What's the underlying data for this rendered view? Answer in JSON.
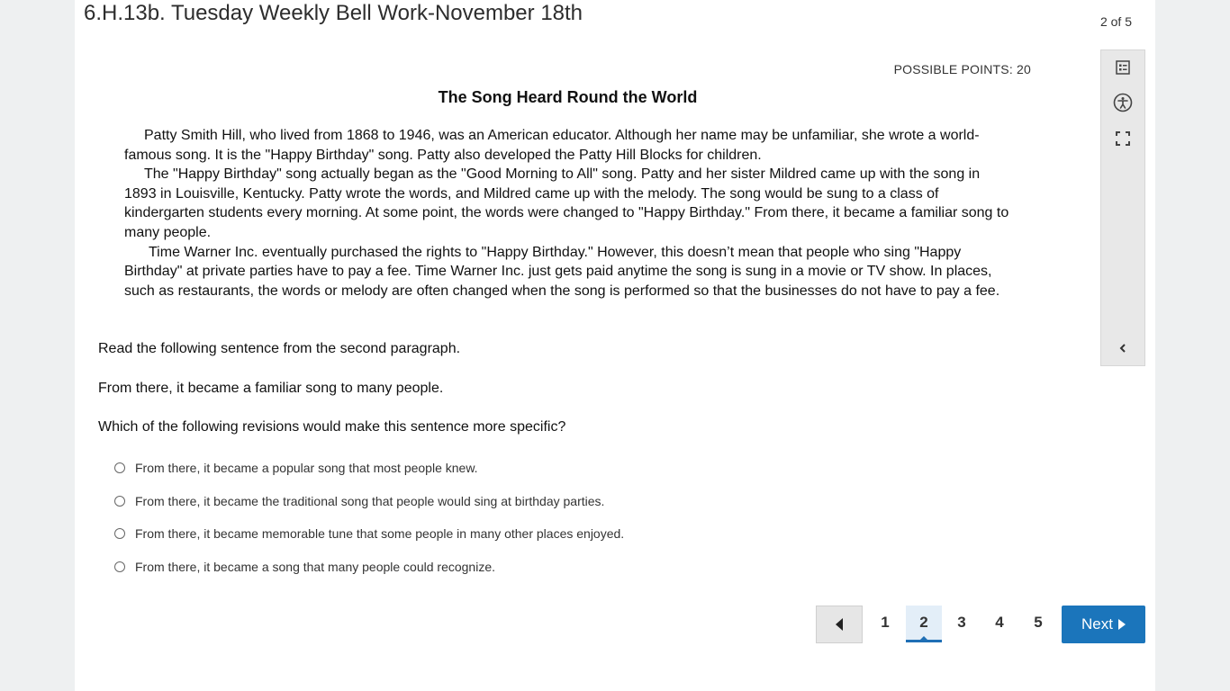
{
  "header": {
    "title": "6.H.13b. Tuesday Weekly Bell Work-November 18th",
    "counter": "2 of 5"
  },
  "question": {
    "points_label": "POSSIBLE POINTS: 20",
    "passage_title": "The Song Heard Round the World",
    "paragraphs": [
      "Patty Smith Hill, who lived from 1868 to 1946, was an American educator. Although her name may be unfamiliar, she wrote a world-famous song. It is the \"Happy Birthday\" song. Patty also developed the Patty Hill Blocks for children.",
      "The \"Happy Birthday\" song actually began as the \"Good Morning to All\" song. Patty and her sister Mildred came up with the song in 1893 in Louisville, Kentucky. Patty wrote the words, and Mildred came up with the melody. The song would be sung to a class of kindergarten students every morning. At some point, the words were changed to \"Happy Birthday.\" From there, it became a familiar song to many people.",
      "Time Warner Inc. eventually purchased the rights to \"Happy Birthday.\" However, this doesn’t mean that people who sing \"Happy Birthday\" at private parties have to pay a fee. Time Warner Inc. just gets paid anytime the song is sung in a movie or TV show. In places, such as restaurants, the words or melody are often changed when the song is performed so that the businesses do not have to pay a fee."
    ],
    "prompt_1": "Read the following sentence from the second paragraph.",
    "prompt_2": "From there, it became a familiar song to many people.",
    "prompt_3": "Which of the following revisions would make this sentence more specific?",
    "choices": [
      "From there, it became a popular song that most people knew.",
      "From there, it became the traditional song that people would sing at birthday parties.",
      "From there, it became memorable tune that some people in many other places enjoyed.",
      "From there, it became a song that many people could recognize."
    ]
  },
  "toolbar": {
    "icons": [
      "question-list-icon",
      "accessibility-icon",
      "fullscreen-icon",
      "collapse-chevron-icon"
    ]
  },
  "pagination": {
    "pages": [
      "1",
      "2",
      "3",
      "4",
      "5"
    ],
    "current": "2",
    "next_label": "Next"
  },
  "colors": {
    "accent": "#1b75bb",
    "active_page_bg": "#e3eef8",
    "background": "#eef0f1"
  }
}
